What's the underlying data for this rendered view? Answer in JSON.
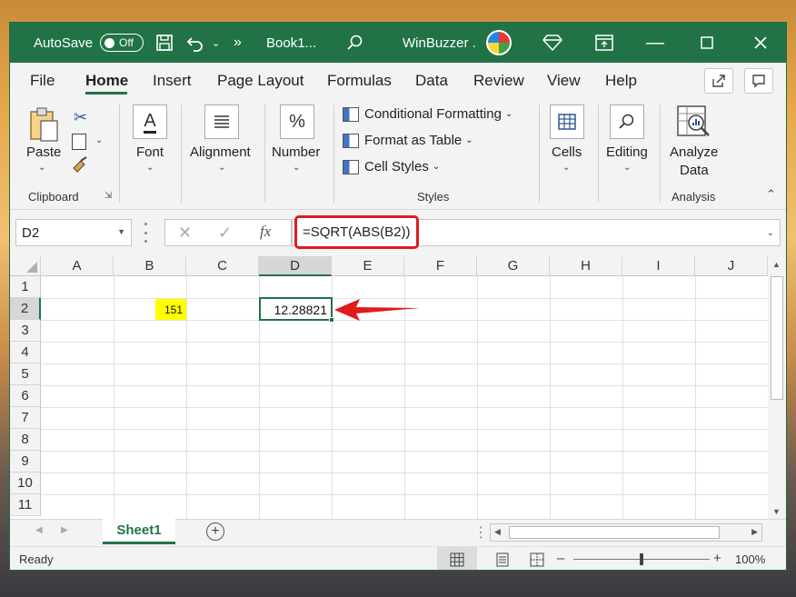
{
  "titlebar": {
    "autosave_label": "AutoSave",
    "autosave_state": "Off",
    "more_label": "»",
    "filename": "Book1...",
    "brand": "WinBuzzer ."
  },
  "menu": {
    "items": [
      "File",
      "Home",
      "Insert",
      "Page Layout",
      "Formulas",
      "Data",
      "Review",
      "View",
      "Help"
    ],
    "active": "Home"
  },
  "ribbon": {
    "paste_label": "Paste",
    "clipboard_group": "Clipboard",
    "font_label": "Font",
    "alignment_label": "Alignment",
    "number_label": "Number",
    "number_icon": "%",
    "conditional_formatting": "Conditional Formatting",
    "format_as_table": "Format as Table",
    "cell_styles": "Cell Styles",
    "styles_group": "Styles",
    "cells_label": "Cells",
    "editing_label": "Editing",
    "analyze_label_1": "Analyze",
    "analyze_label_2": "Data",
    "analysis_group": "Analysis"
  },
  "formula_bar": {
    "name_box": "D2",
    "fx_label": "fx",
    "formula": "=SQRT(ABS(B2))",
    "highlight_color": "#e01b1b"
  },
  "sheet": {
    "columns": [
      "A",
      "B",
      "C",
      "D",
      "E",
      "F",
      "G",
      "H",
      "I",
      "J"
    ],
    "rows": [
      "1",
      "2",
      "3",
      "4",
      "5",
      "6",
      "7",
      "8",
      "9",
      "10",
      "11"
    ],
    "cells": {
      "B2": "151",
      "B2_fill": "#ffff00",
      "D2": "12.28821"
    },
    "arrow_color": "#e01b1b"
  },
  "tabs": {
    "active_sheet": "Sheet1",
    "add_sheet": "+"
  },
  "status": {
    "ready": "Ready",
    "zoom": "100%"
  }
}
